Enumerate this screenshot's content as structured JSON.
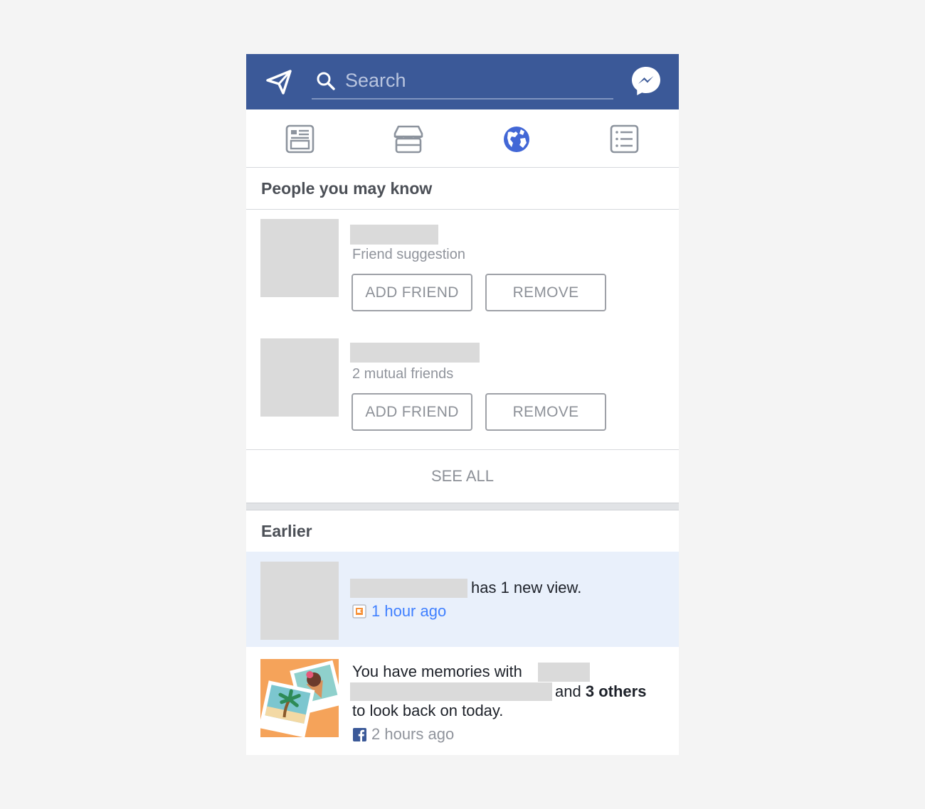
{
  "header": {
    "search_placeholder": "Search",
    "brand_color": "#3b5998",
    "icons": [
      "paper-plane-icon",
      "search-icon",
      "messenger-icon"
    ]
  },
  "tabs": [
    {
      "icon": "news-feed-icon",
      "active": false
    },
    {
      "icon": "marketplace-icon",
      "active": false
    },
    {
      "icon": "notifications-globe-icon",
      "active": true
    },
    {
      "icon": "menu-list-icon",
      "active": false
    }
  ],
  "people": {
    "title": "People you may know",
    "items": [
      {
        "subtitle": "Friend suggestion",
        "add_label": "ADD FRIEND",
        "remove_label": "REMOVE"
      },
      {
        "subtitle": "2 mutual friends",
        "add_label": "ADD FRIEND",
        "remove_label": "REMOVE"
      }
    ],
    "see_all": "SEE ALL"
  },
  "earlier": {
    "title": "Earlier",
    "items": [
      {
        "text": "has 1 new view.",
        "time": "1 hour ago",
        "time_color": "#4080ff",
        "icon": "page-flag-icon"
      },
      {
        "text_1": "You have memories with",
        "text_2": "and",
        "text_bold": "3 others",
        "text_3": "to look back on today.",
        "time": "2 hours ago",
        "icon": "facebook-icon"
      }
    ]
  }
}
